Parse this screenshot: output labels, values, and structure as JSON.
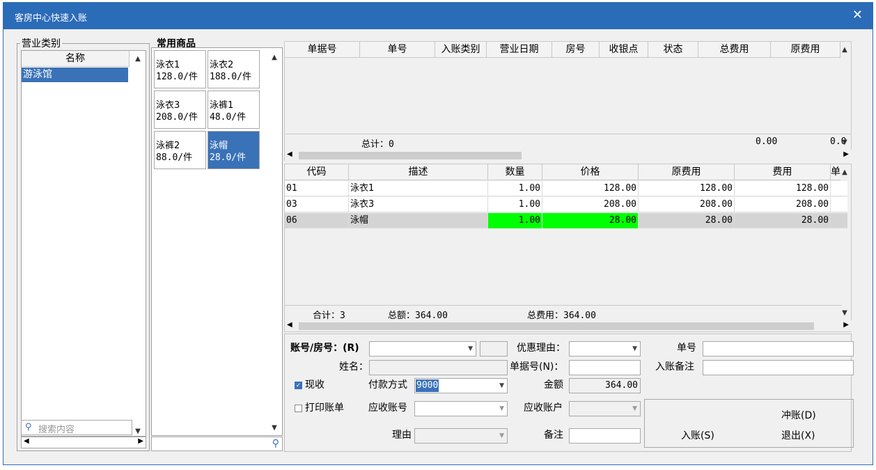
{
  "window": {
    "title": "客房中心快速入账",
    "close_symbol": "✕"
  },
  "category_panel": {
    "label": "营业类别",
    "column": "名称",
    "items": [
      "游泳馆"
    ],
    "search_placeholder": "搜索内容"
  },
  "goods_panel": {
    "label": "常用商品",
    "items": [
      {
        "name": "泳衣1",
        "price": "128.0/件"
      },
      {
        "name": "泳衣2",
        "price": "188.0/件"
      },
      {
        "name": "泳衣3",
        "price": "208.0/件"
      },
      {
        "name": "泳裤1",
        "price": "48.0/件"
      },
      {
        "name": "泳裤2",
        "price": "88.0/件"
      },
      {
        "name": "泳帽",
        "price": "28.0/件"
      }
    ]
  },
  "bill_grid": {
    "columns": [
      "单据号",
      "单号",
      "入账类别",
      "营业日期",
      "房号",
      "收银点",
      "状态",
      "总费用",
      "原费用"
    ],
    "footer_label": "总计：0",
    "footer_total": "0.00",
    "footer_orig": "0.0"
  },
  "detail_grid": {
    "columns": [
      "代码",
      "描述",
      "数量",
      "价格",
      "原费用",
      "费用",
      "单"
    ],
    "rows": [
      {
        "code": "01",
        "desc": "泳衣1",
        "qty": "1.00",
        "price": "128.00",
        "orig": "128.00",
        "fee": "128.00"
      },
      {
        "code": "03",
        "desc": "泳衣3",
        "qty": "1.00",
        "price": "208.00",
        "orig": "208.00",
        "fee": "208.00"
      },
      {
        "code": "06",
        "desc": "泳帽",
        "qty": "1.00",
        "price": "28.00",
        "orig": "28.00",
        "fee": "28.00"
      }
    ],
    "footer_count": "合计：3",
    "footer_amount": "总额：364.00",
    "footer_fee": "总费用：364.00"
  },
  "form": {
    "account_label": "账号/房号：(R)",
    "name_label": "姓名：",
    "cash_label": "现收",
    "pay_method_label": "付款方式",
    "pay_method_value": "9000",
    "print_label": "打印账单",
    "ar_account_label": "应收账号",
    "reason_label": "理由",
    "discount_label": "优惠理由：",
    "bill_no_label": "单据号(N)：",
    "amount_label": "金额",
    "amount_value": "364.00",
    "ar_user_label": "应收账户",
    "remark_label": "备注",
    "order_no_label": "单号",
    "post_remark_label": "入账备注"
  },
  "buttons": {
    "post": "入账(S)",
    "reverse": "冲账(D)",
    "exit": "退出(X)"
  },
  "colors": {
    "title_bar": "#2b6cb8",
    "selection": "#3a72b8",
    "highlight": "#00ff00"
  }
}
